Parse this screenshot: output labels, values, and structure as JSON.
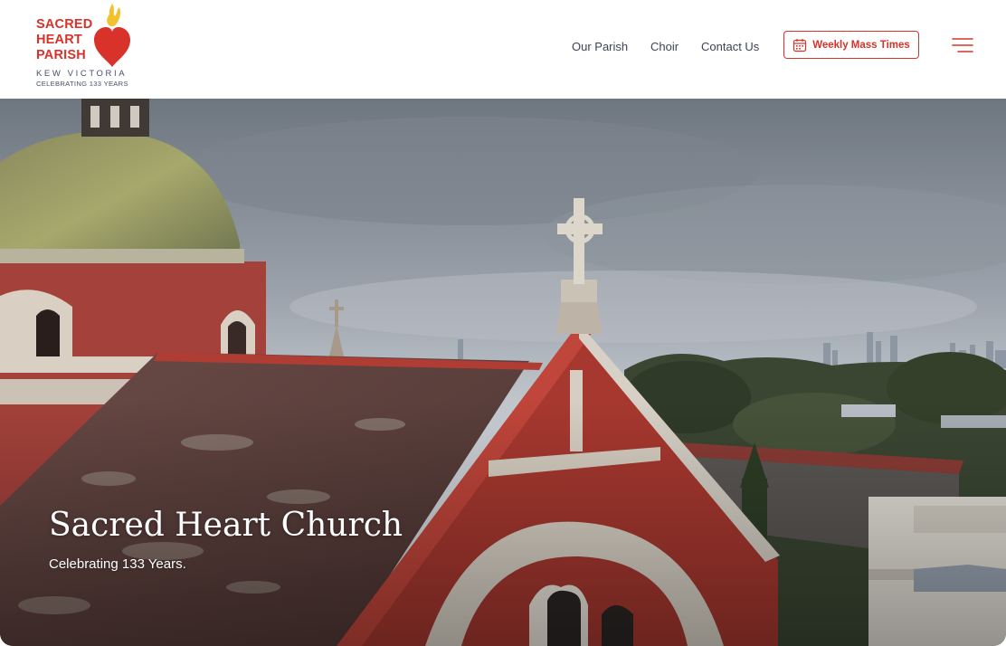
{
  "logo": {
    "line1": "SACRED",
    "line2": "HEART",
    "line3": "PARISH",
    "location": "KEW VICTORIA",
    "tagline": "CELEBRATING 133 YEARS",
    "icon": "flaming-heart-icon"
  },
  "nav": {
    "items": [
      {
        "label": "Our Parish"
      },
      {
        "label": "Choir"
      },
      {
        "label": "Contact Us"
      }
    ],
    "mass_button": {
      "label": "Weekly Mass Times",
      "icon": "calendar-icon"
    },
    "menu_icon": "hamburger-menu-icon"
  },
  "hero": {
    "title": "Sacred Heart Church",
    "subtitle": "Celebrating 133 Years."
  },
  "colors": {
    "brand_red": "#d8322b",
    "nav_text": "#3d4357",
    "logo_sub": "#48506a"
  }
}
